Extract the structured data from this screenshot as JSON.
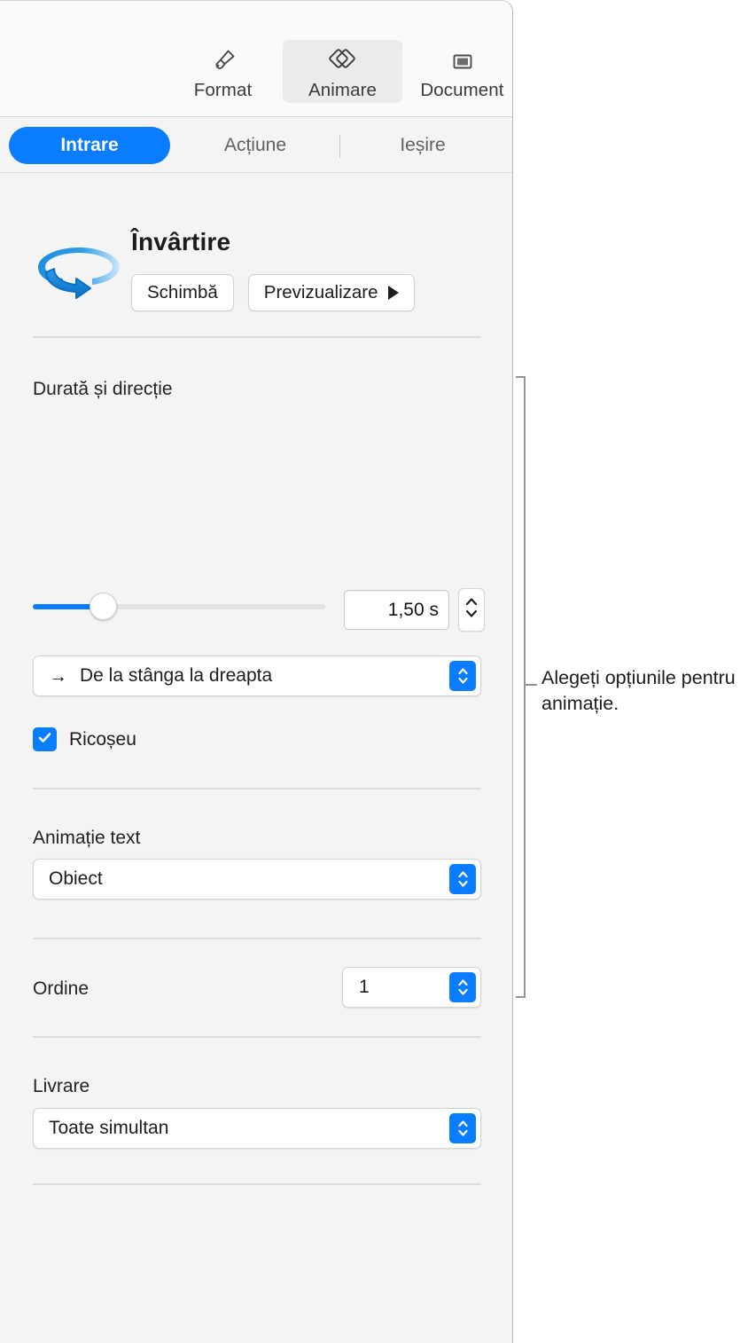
{
  "toolbar": {
    "items": [
      {
        "label": "Format",
        "icon": "paintbrush-icon",
        "selected": false
      },
      {
        "label": "Animare",
        "icon": "animate-diamonds-icon",
        "selected": true
      },
      {
        "label": "Document",
        "icon": "document-rectangle-icon",
        "selected": false
      }
    ]
  },
  "tabs": {
    "items": [
      {
        "label": "Intrare",
        "active": true
      },
      {
        "label": "Acțiune",
        "active": false
      },
      {
        "label": "Ieșire",
        "active": false
      }
    ]
  },
  "animation": {
    "icon": "spin-arrow-icon",
    "title": "Învârtire",
    "change_button": "Schimbă",
    "preview_button": "Previzualizare",
    "preview_icon": "play-triangle-icon"
  },
  "duration_section": {
    "label": "Durată și direcție",
    "slider": {
      "value_percent": 23
    },
    "duration_value": "1,50 s",
    "stepper_icon": "stepper-up-down-icon",
    "direction": {
      "arrow_icon": "arrow-right-icon",
      "value": "De la stânga la dreapta",
      "popup_icon": "popup-up-down-icon"
    },
    "bounce": {
      "label": "Ricoșeu",
      "checked": true,
      "icon": "checkmark-icon"
    }
  },
  "text_animation_section": {
    "label": "Animație text",
    "value": "Obiect",
    "popup_icon": "popup-up-down-icon"
  },
  "order_section": {
    "label": "Ordine",
    "value": "1",
    "popup_icon": "popup-up-down-icon"
  },
  "delivery_section": {
    "label": "Livrare",
    "value": "Toate simultan",
    "popup_icon": "popup-up-down-icon"
  },
  "callout": {
    "text": "Alegeți opțiunile pentru animație.",
    "bracket_color": "#949494"
  },
  "colors": {
    "accent_blue": "#0A7CFF",
    "panel_background": "#F4F4F4",
    "toolbar_background": "#FAFAFA",
    "separator": "#DCDCDC"
  }
}
